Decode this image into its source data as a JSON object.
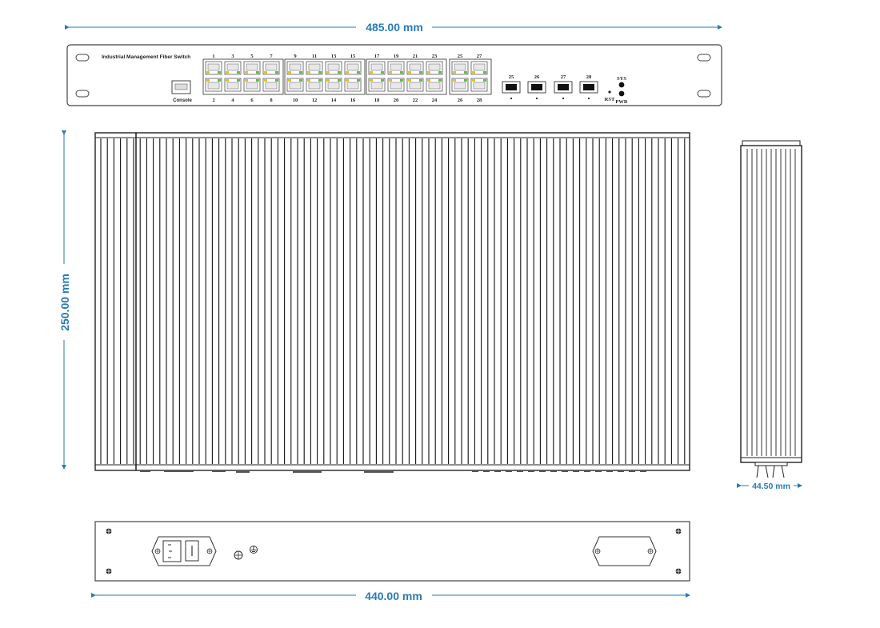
{
  "dimensions": {
    "width_overall": "485.00 mm",
    "depth": "250.00 mm",
    "height": "44.50 mm",
    "width_body": "440.00 mm"
  },
  "front_panel": {
    "title": "Industrial Management Fiber Switch",
    "console_label": "Console",
    "rj45_top_numbers": [
      "1",
      "3",
      "5",
      "7",
      "9",
      "11",
      "13",
      "15",
      "17",
      "19",
      "21",
      "23"
    ],
    "rj45_bottom_numbers": [
      "2",
      "4",
      "6",
      "8",
      "10",
      "12",
      "14",
      "16",
      "18",
      "20",
      "22",
      "24"
    ],
    "combo_top_numbers": [
      "25",
      "27"
    ],
    "combo_bottom_numbers": [
      "26",
      "28"
    ],
    "sfp_numbers": [
      "25",
      "26",
      "27",
      "28"
    ],
    "rst_label": "RST",
    "sys_label": "SYS",
    "pwr_label": "PWR"
  },
  "colors": {
    "dimension": "#2a7ab5",
    "led_green": "#5cc04a",
    "led_yellow": "#e6c21e",
    "outline": "#333333"
  }
}
